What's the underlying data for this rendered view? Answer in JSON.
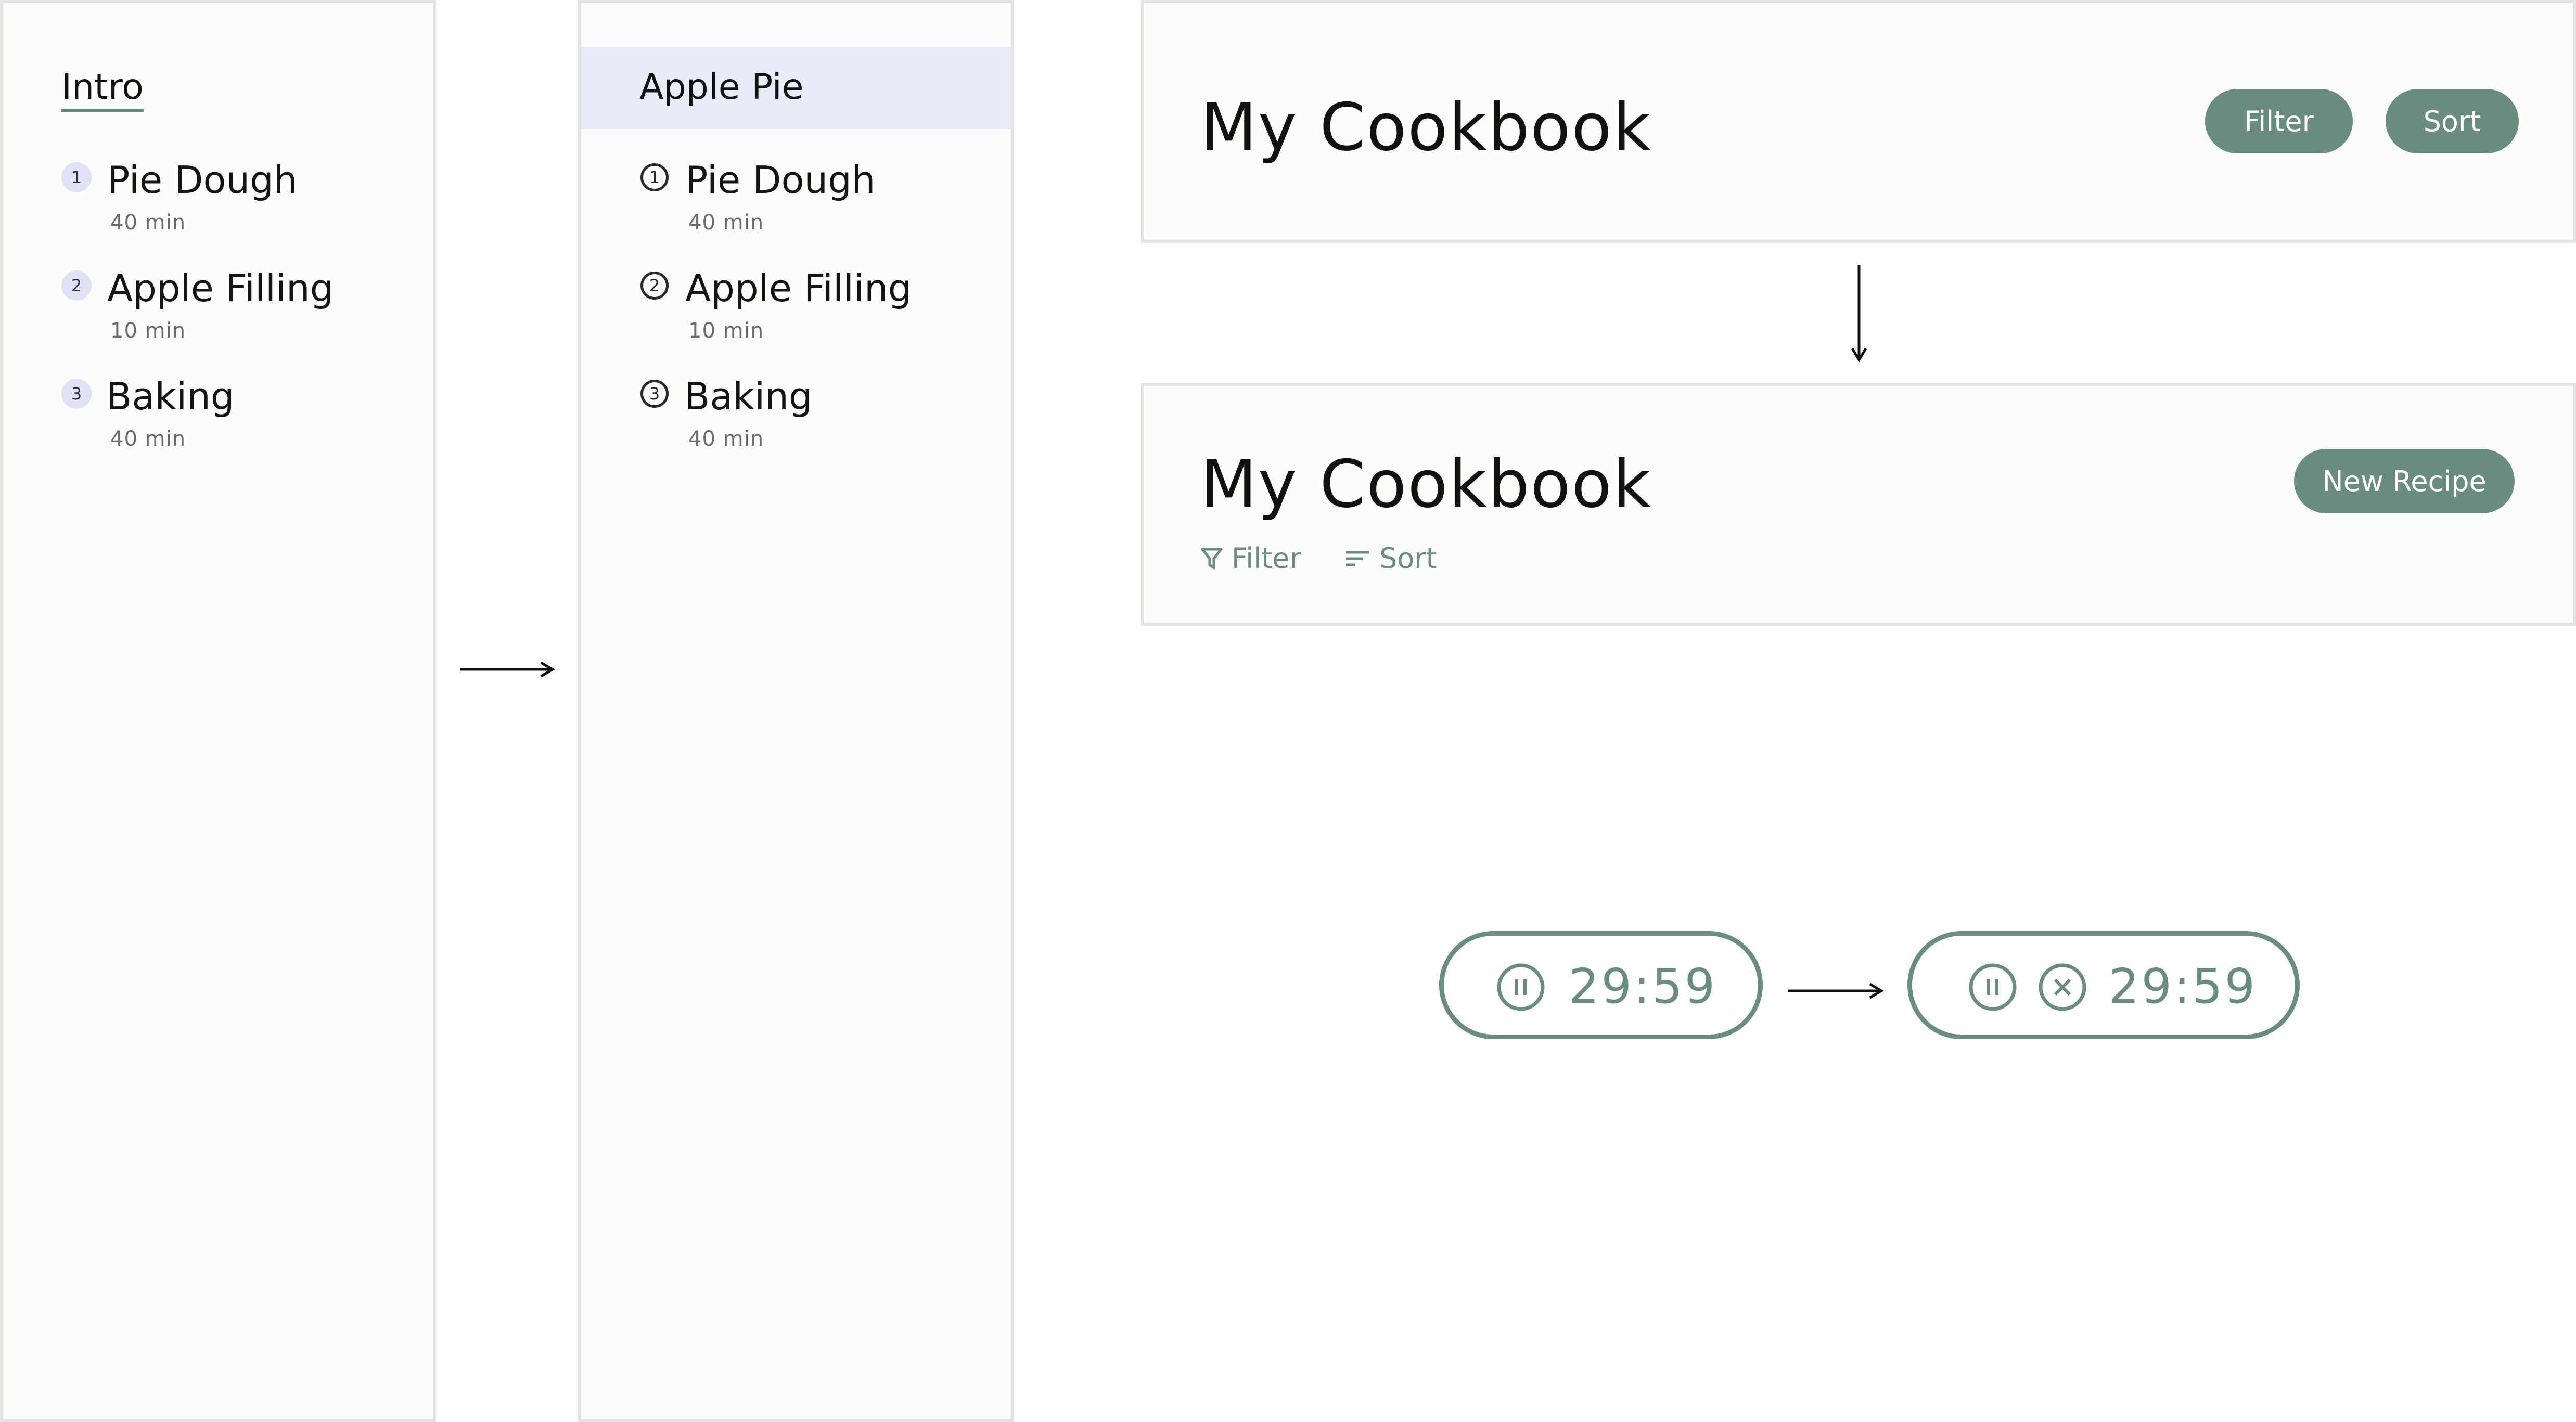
{
  "panel_before": {
    "heading": "Intro",
    "steps": [
      {
        "number": "1",
        "label": "Pie Dough",
        "time": "40 min"
      },
      {
        "number": "2",
        "label": "Apple Filling",
        "time": "10 min"
      },
      {
        "number": "3",
        "label": "Baking",
        "time": "40 min"
      }
    ]
  },
  "panel_after": {
    "heading": "Apple Pie",
    "steps": [
      {
        "number": "1",
        "label": "Pie Dough",
        "time": "40 min"
      },
      {
        "number": "2",
        "label": "Apple Filling",
        "time": "10 min"
      },
      {
        "number": "3",
        "label": "Baking",
        "time": "40 min"
      }
    ]
  },
  "header_before": {
    "title": "My Cookbook",
    "filter_label": "Filter",
    "sort_label": "Sort"
  },
  "header_after": {
    "title": "My Cookbook",
    "new_recipe_label": "New Recipe",
    "filter_label": "Filter",
    "sort_label": "Sort"
  },
  "timer_before": {
    "time": "29:59"
  },
  "timer_after": {
    "time": "29:59"
  },
  "colors": {
    "accent": "#6b8c81",
    "panel_bg": "#fcfcfa",
    "selected_bg": "#e8ebf8",
    "badge_bg": "#dfe3f5"
  },
  "icons": [
    "arrow-right-icon",
    "arrow-down-icon",
    "filter-icon",
    "sort-icon",
    "pause-icon",
    "close-icon"
  ]
}
